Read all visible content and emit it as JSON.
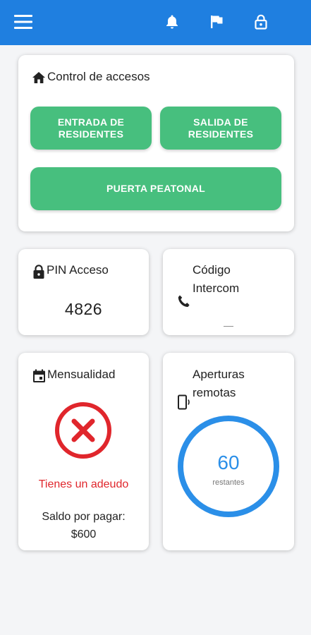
{
  "topbar": {
    "color": "#1f7fe0",
    "icons": [
      "menu-icon",
      "bell-icon",
      "flag-icon",
      "lock-icon"
    ]
  },
  "access": {
    "title": "Control de accesos",
    "buttons": {
      "entrada": "ENTRADA DE\nRESIDENTES",
      "salida": "SALIDA DE\nRESIDENTES",
      "peatonal": "PUERTA PEATONAL"
    },
    "button_color": "#47bf7e"
  },
  "pin": {
    "title": "PIN Acceso",
    "value": "4826"
  },
  "intercom": {
    "title": "Código\nIntercom",
    "value": "—"
  },
  "monthly": {
    "title": "Mensualidad",
    "status_icon": "error-x-icon",
    "status_color": "#e0262c",
    "debt_message": "Tienes un adeudo",
    "balance_label": "Saldo por pagar:",
    "balance_value": "$600"
  },
  "remote": {
    "title": "Aperturas\nremotas",
    "count": "60",
    "count_label": "restantes",
    "ring_color": "#2b8fe8"
  }
}
